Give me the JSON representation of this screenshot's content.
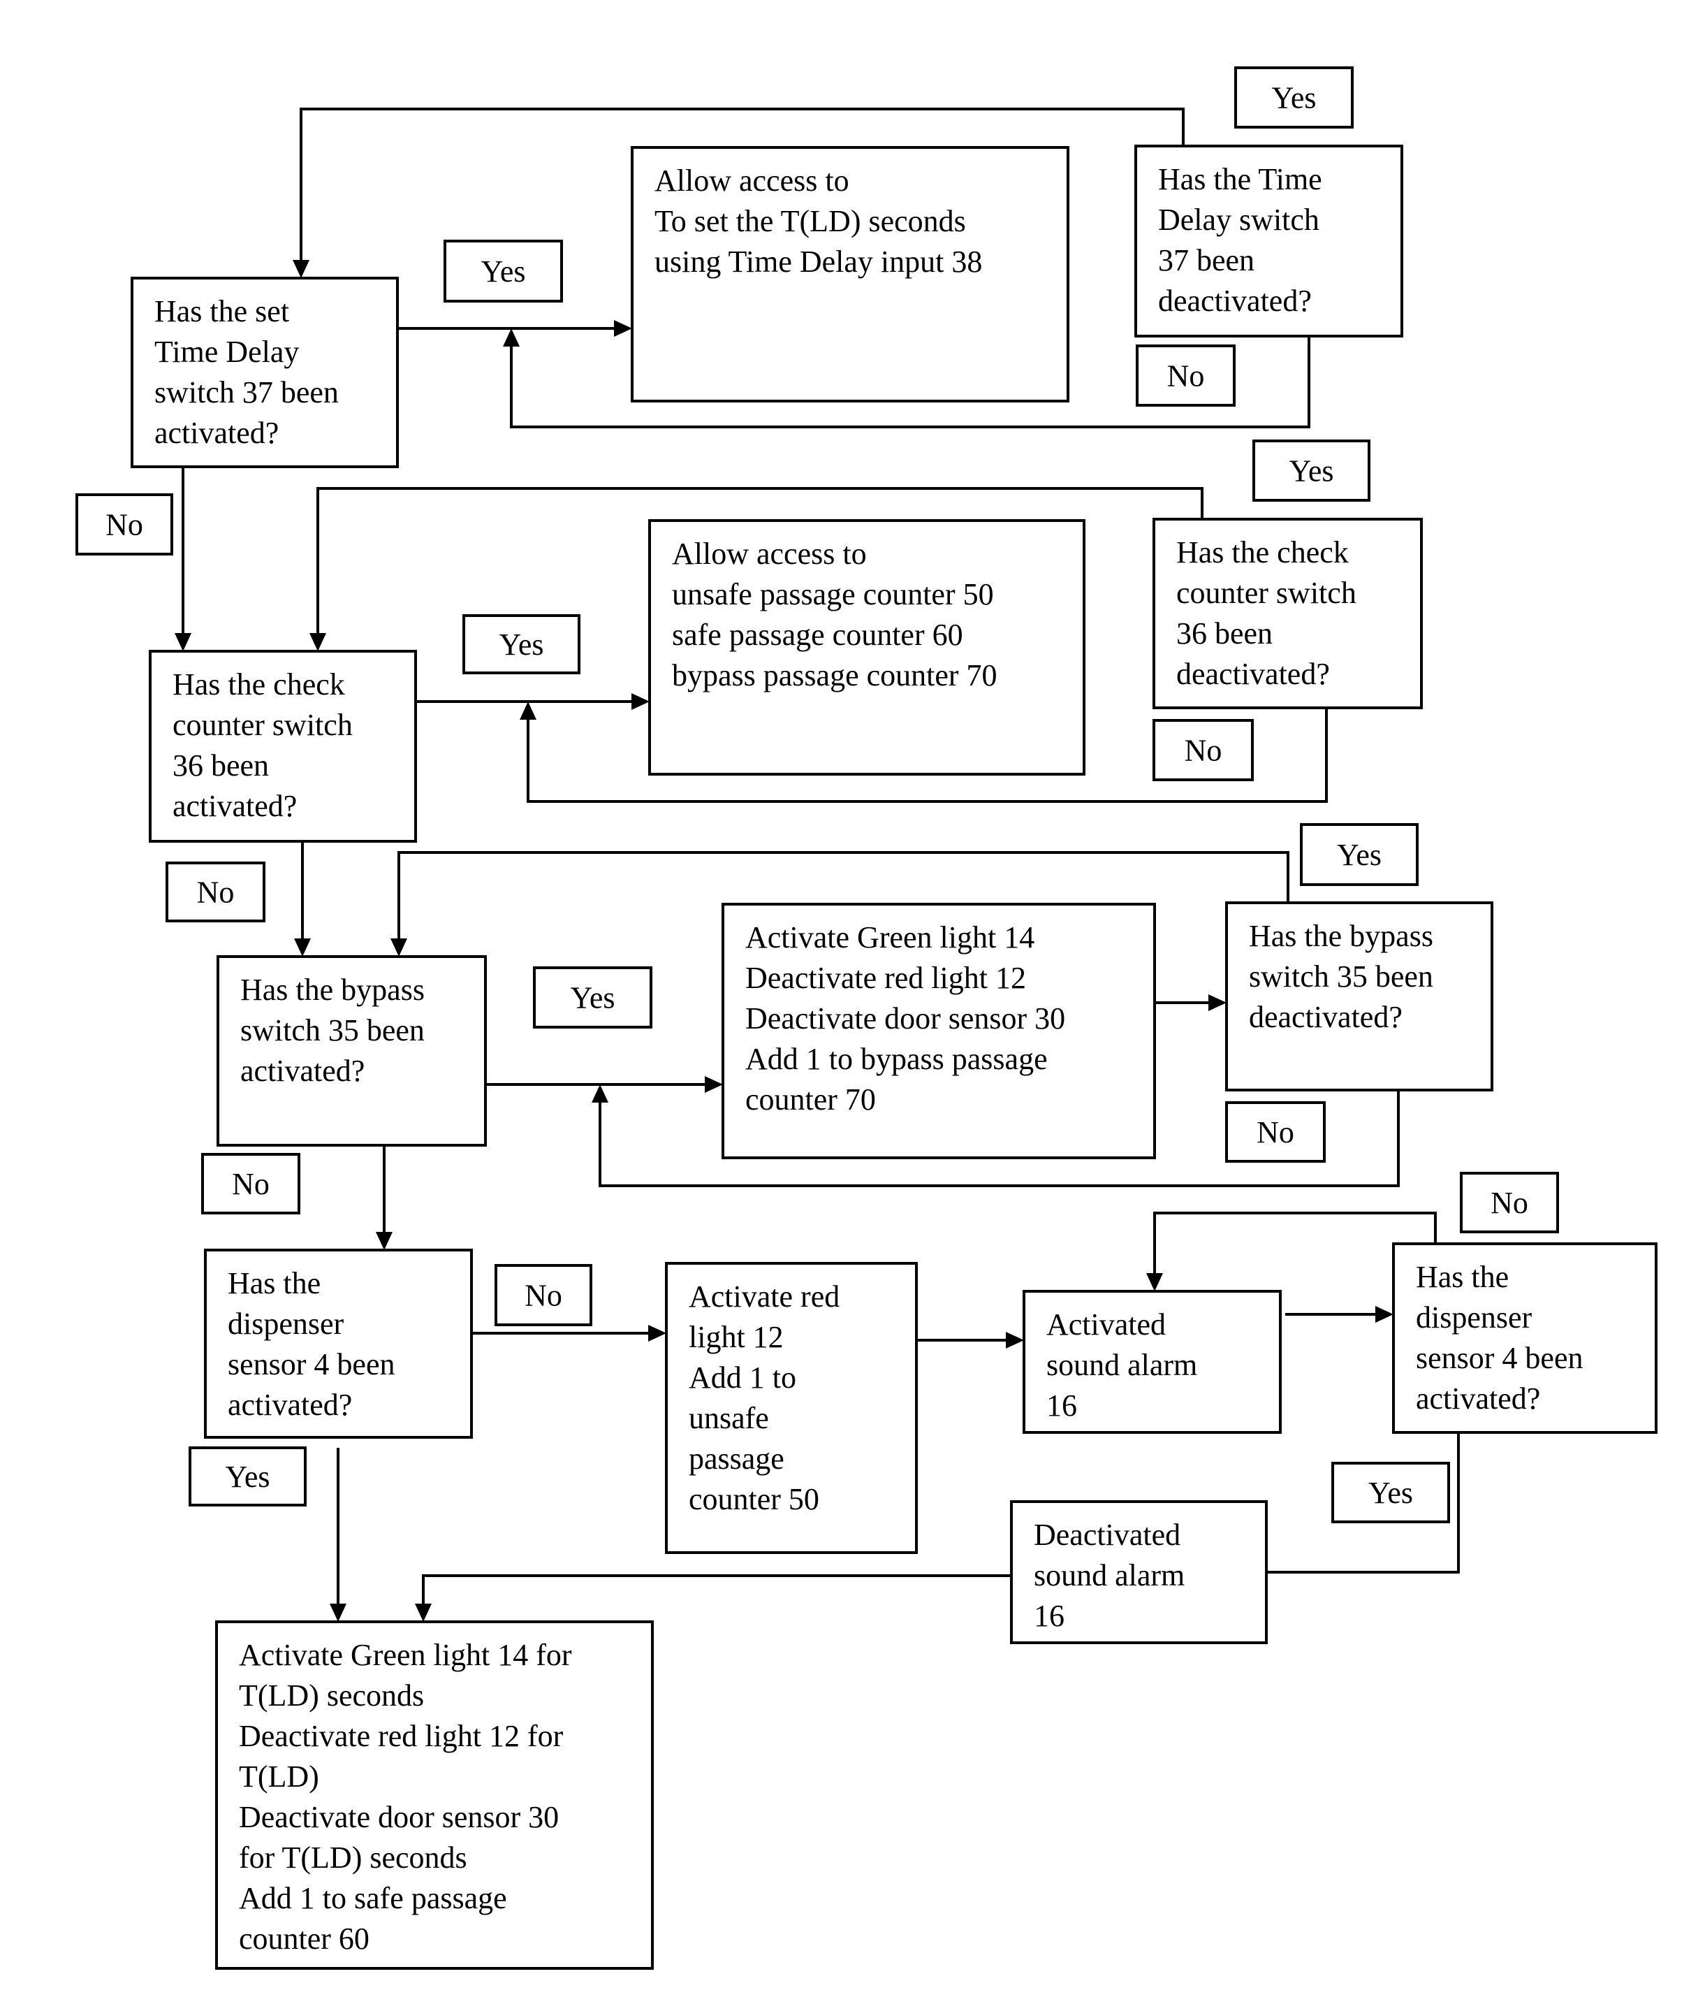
{
  "diagram": {
    "type": "flowchart",
    "nodes": [
      {
        "id": "q_timedelay_on",
        "kind": "decision",
        "lines": [
          "Has the set",
          "Time Delay",
          "switch 37 been",
          "activated?"
        ]
      },
      {
        "id": "p_set_tld",
        "kind": "process",
        "lines": [
          "Allow access to",
          "To set the T(LD) seconds",
          "using Time Delay input 38"
        ]
      },
      {
        "id": "q_timedelay_off",
        "kind": "decision",
        "lines": [
          "Has the Time",
          "Delay  switch",
          "37 been",
          "deactivated?"
        ]
      },
      {
        "id": "q_check_on",
        "kind": "decision",
        "lines": [
          "Has the check",
          "counter switch",
          "36 been",
          "activated?"
        ]
      },
      {
        "id": "p_counters",
        "kind": "process",
        "lines": [
          "Allow access to",
          "unsafe passage counter 50",
          "safe passage  counter 60",
          "bypass passage counter 70"
        ]
      },
      {
        "id": "q_check_off",
        "kind": "decision",
        "lines": [
          "Has the check",
          "counter switch",
          "36 been",
          "deactivated?"
        ]
      },
      {
        "id": "q_bypass_on",
        "kind": "decision",
        "lines": [
          "Has the bypass",
          "switch 35 been",
          "activated?"
        ]
      },
      {
        "id": "p_bypass",
        "kind": "process",
        "lines": [
          "Activate Green light 14",
          "Deactivate red light 12",
          "Deactivate door sensor 30",
          "Add 1 to bypass passage",
          "counter 70"
        ]
      },
      {
        "id": "q_bypass_off",
        "kind": "decision",
        "lines": [
          "Has the bypass",
          "switch 35 been",
          "deactivated?"
        ]
      },
      {
        "id": "q_dispenser",
        "kind": "decision",
        "lines": [
          "Has the",
          "dispenser",
          "sensor 4 been",
          "activated?"
        ]
      },
      {
        "id": "p_unsafe",
        "kind": "process",
        "lines": [
          "Activate red",
          "light 12",
          "Add 1 to",
          "unsafe",
          "passage",
          "counter 50"
        ]
      },
      {
        "id": "p_alarm_on",
        "kind": "process",
        "lines": [
          "Activated",
          "sound alarm",
          "16"
        ]
      },
      {
        "id": "q_dispenser_again",
        "kind": "decision",
        "lines": [
          "Has the",
          "dispenser",
          "sensor 4 been",
          "activated?"
        ]
      },
      {
        "id": "p_alarm_off",
        "kind": "process",
        "lines": [
          "Deactivated",
          "sound alarm",
          "16"
        ]
      },
      {
        "id": "p_safe",
        "kind": "process",
        "lines": [
          "Activate Green light 14 for",
          "T(LD) seconds",
          "Deactivate red light 12 for",
          "T(LD)",
          "Deactivate door sensor 30",
          "for T(LD) seconds",
          "Add 1 to safe passage",
          "counter 60"
        ]
      }
    ],
    "labels": [
      {
        "id": "yes_timedelay",
        "text": "Yes"
      },
      {
        "id": "yes_timedelay_off",
        "text": "Yes"
      },
      {
        "id": "no_timedelay_off",
        "text": "No"
      },
      {
        "id": "no_timedelay",
        "text": "No"
      },
      {
        "id": "yes_check",
        "text": "Yes"
      },
      {
        "id": "yes_check_off",
        "text": "Yes"
      },
      {
        "id": "no_check_off",
        "text": "No"
      },
      {
        "id": "no_check",
        "text": "No"
      },
      {
        "id": "yes_bypass",
        "text": "Yes"
      },
      {
        "id": "yes_bypass_off",
        "text": "Yes"
      },
      {
        "id": "no_bypass_off",
        "text": "No"
      },
      {
        "id": "no_bypass",
        "text": "No"
      },
      {
        "id": "no_dispenser",
        "text": "No"
      },
      {
        "id": "yes_dispenser",
        "text": "Yes"
      },
      {
        "id": "no_dispenser_again",
        "text": "No"
      },
      {
        "id": "yes_dispenser_again",
        "text": "Yes"
      }
    ],
    "edges": [
      {
        "from": "q_timedelay_on",
        "to": "p_set_tld",
        "label": "Yes"
      },
      {
        "from": "q_timedelay_off",
        "to": "q_timedelay_on",
        "label": "Yes"
      },
      {
        "from": "q_timedelay_off",
        "to": "p_set_tld",
        "label": "No"
      },
      {
        "from": "q_timedelay_on",
        "to": "q_check_on",
        "label": "No"
      },
      {
        "from": "q_check_on",
        "to": "p_counters",
        "label": "Yes"
      },
      {
        "from": "q_check_off",
        "to": "q_check_on",
        "label": "Yes"
      },
      {
        "from": "q_check_off",
        "to": "p_counters",
        "label": "No"
      },
      {
        "from": "q_check_on",
        "to": "q_bypass_on",
        "label": "No"
      },
      {
        "from": "q_bypass_on",
        "to": "p_bypass",
        "label": "Yes"
      },
      {
        "from": "p_bypass",
        "to": "q_bypass_off",
        "label": ""
      },
      {
        "from": "q_bypass_off",
        "to": "q_bypass_on",
        "label": "Yes"
      },
      {
        "from": "q_bypass_off",
        "to": "p_bypass",
        "label": "No"
      },
      {
        "from": "q_bypass_on",
        "to": "q_dispenser",
        "label": "No"
      },
      {
        "from": "q_dispenser",
        "to": "p_unsafe",
        "label": "No"
      },
      {
        "from": "p_unsafe",
        "to": "p_alarm_on",
        "label": ""
      },
      {
        "from": "p_alarm_on",
        "to": "q_dispenser_again",
        "label": ""
      },
      {
        "from": "q_dispenser_again",
        "to": "p_alarm_on",
        "label": "No"
      },
      {
        "from": "q_dispenser_again",
        "to": "p_alarm_off",
        "label": "Yes"
      },
      {
        "from": "p_alarm_off",
        "to": "p_safe",
        "label": ""
      },
      {
        "from": "q_dispenser",
        "to": "p_safe",
        "label": "Yes"
      }
    ]
  }
}
